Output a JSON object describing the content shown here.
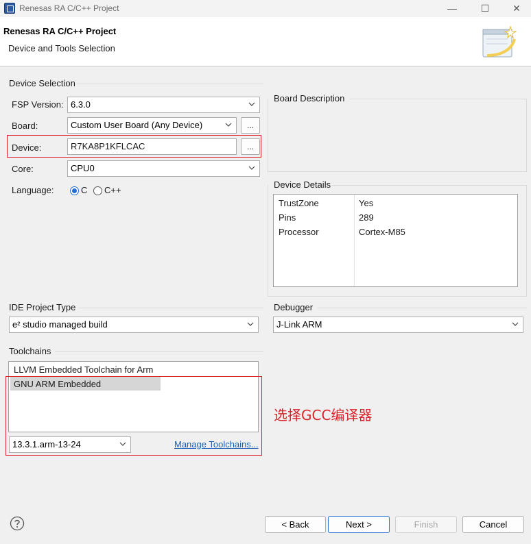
{
  "window": {
    "title": "Renesas RA C/C++ Project",
    "controls": {
      "minimize": "—",
      "maximize": "☐",
      "close": "✕"
    }
  },
  "header": {
    "title": "Renesas RA C/C++ Project",
    "subtitle": "Device and Tools Selection",
    "banner_icon": "wizard-banner-icon"
  },
  "device_selection": {
    "group_label": "Device Selection",
    "fsp_version_label": "FSP Version:",
    "fsp_version_value": "6.3.0",
    "board_label": "Board:",
    "board_value": "Custom User Board (Any Device)",
    "board_browse": "...",
    "device_label": "Device:",
    "device_value": "R7KA8P1KFLCAC",
    "device_browse": "...",
    "core_label": "Core:",
    "core_value": "CPU0",
    "language_label": "Language:",
    "language_options": [
      {
        "label": "C",
        "selected": true
      },
      {
        "label": "C++",
        "selected": false
      }
    ]
  },
  "board_description": {
    "group_label": "Board Description"
  },
  "device_details": {
    "group_label": "Device Details",
    "rows": [
      {
        "key": "TrustZone",
        "value": "Yes"
      },
      {
        "key": "Pins",
        "value": "289"
      },
      {
        "key": "Processor",
        "value": "Cortex-M85"
      }
    ]
  },
  "ide_project_type": {
    "group_label": "IDE Project Type",
    "value": "e² studio managed build"
  },
  "debugger": {
    "group_label": "Debugger",
    "value": "J-Link ARM"
  },
  "toolchains": {
    "group_label": "Toolchains",
    "items": [
      {
        "label": "LLVM Embedded Toolchain for Arm",
        "selected": false
      },
      {
        "label": "GNU ARM Embedded",
        "selected": true
      }
    ],
    "version_value": "13.3.1.arm-13-24",
    "manage_link": "Manage Toolchains..."
  },
  "annotation": {
    "text": "选择GCC编译器",
    "color": "#d9242b"
  },
  "footer": {
    "help_icon": "help-icon",
    "back_label": "< Back",
    "next_label": "Next >",
    "finish_label": "Finish",
    "cancel_label": "Cancel"
  }
}
